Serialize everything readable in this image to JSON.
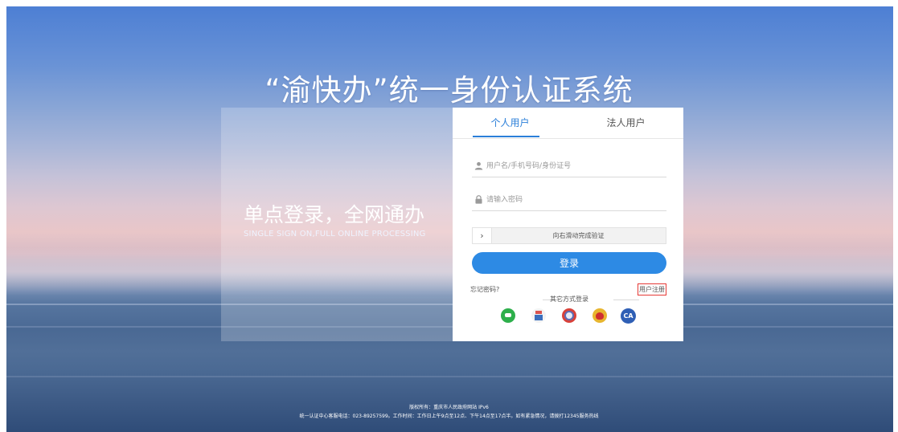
{
  "page": {
    "title": "“渝快办”统一身份认证系统"
  },
  "promo": {
    "slogan": "单点登录，全网通办",
    "subtitle": "SINGLE SIGN ON,FULL ONLINE PROCESSING"
  },
  "login": {
    "tabs": [
      {
        "label": "个人用户",
        "active": true
      },
      {
        "label": "法人用户",
        "active": false
      }
    ],
    "username": {
      "placeholder": "用户名/手机号码/身份证号",
      "value": "",
      "icon": "user-icon"
    },
    "password": {
      "placeholder": "请输入密码",
      "value": "",
      "icon": "lock-icon"
    },
    "slider": {
      "handle": "›",
      "text": "向右滑动完成验证"
    },
    "submit_label": "登录",
    "forgot_label": "忘记密码?",
    "register_label": "用户注册",
    "other_methods_label": "其它方式登录",
    "other_methods": [
      {
        "icon": "wechat-icon"
      },
      {
        "icon": "mobile-app-icon"
      },
      {
        "icon": "police-badge-icon"
      },
      {
        "icon": "national-emblem-icon"
      },
      {
        "icon": "ca-certificate-icon",
        "text": "CA"
      }
    ]
  },
  "footer": {
    "copyright": "版权所有：重庆市人民政府网站 IPv6",
    "contact": "统一认证中心客服电话：023-89257599。工作时间：工作日上午9点至12点、下午14点至17点半。如有紧急情况，请拨打12345服务热线"
  },
  "colors": {
    "accent": "#2d8ae4",
    "register_highlight": "#e53935"
  }
}
